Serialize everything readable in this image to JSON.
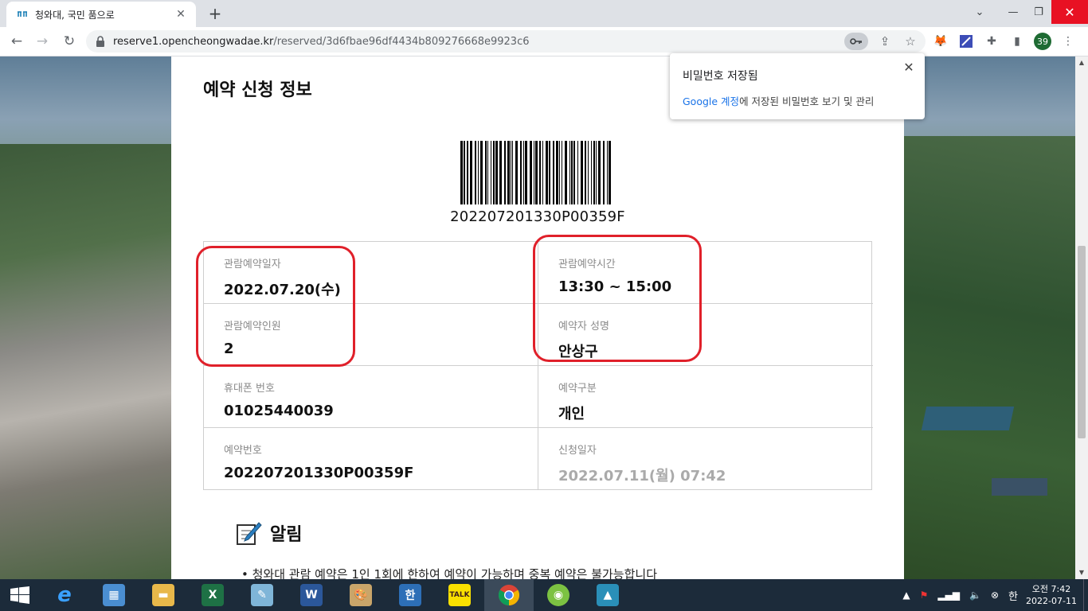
{
  "browser": {
    "tab_title": "청와대, 국민 품으로",
    "tab_close": "✕",
    "new_tab": "+",
    "url_host": "reserve1.opencheongwadae.kr",
    "url_path": "/reserved/3d6fbae96df4434b809276668e9923c6",
    "profile_count": "39"
  },
  "password_popup": {
    "title": "비밀번호 저장됨",
    "link": "Google 계정",
    "desc": "에 저장된 비밀번호 보기 및 관리",
    "close": "✕"
  },
  "page": {
    "heading": "예약 신청 정보",
    "barcode_number": "202207201330P00359F",
    "info": [
      {
        "label": "관람예약일자",
        "value": "2022.07.20(수)",
        "muted": false
      },
      {
        "label": "관람예약시간",
        "value": "13:30 ~ 15:00",
        "muted": false
      },
      {
        "label": "관람예약인원",
        "value": "2",
        "muted": false
      },
      {
        "label": "예약자 성명",
        "value": "안상구",
        "muted": false
      },
      {
        "label": "휴대폰 번호",
        "value": "01025440039",
        "muted": false
      },
      {
        "label": "예약구분",
        "value": "개인",
        "muted": false
      },
      {
        "label": "예약번호",
        "value": "202207201330P00359F",
        "muted": false
      },
      {
        "label": "신청일자",
        "value": "2022.07.11(월) 07:42",
        "muted": true
      }
    ],
    "notice_title": "알림",
    "notice_items": [
      "청와대 관람 예약은 1인 1회에 한하여 예약이 가능하며 중복 예약은 불가능합니다"
    ]
  },
  "taskbar": {
    "apps": [
      "internet-explorer",
      "control-panel",
      "file-explorer",
      "excel",
      "notepad",
      "word",
      "paint",
      "hangul",
      "kakaotalk",
      "chrome",
      "green-app",
      "photos"
    ],
    "ime": "한",
    "time": "오전 7:42",
    "date": "2022-07-11"
  },
  "colors": {
    "highlight_red": "#e0202a",
    "link_blue": "#1a73e8",
    "taskbar": "#1c2b3a"
  }
}
